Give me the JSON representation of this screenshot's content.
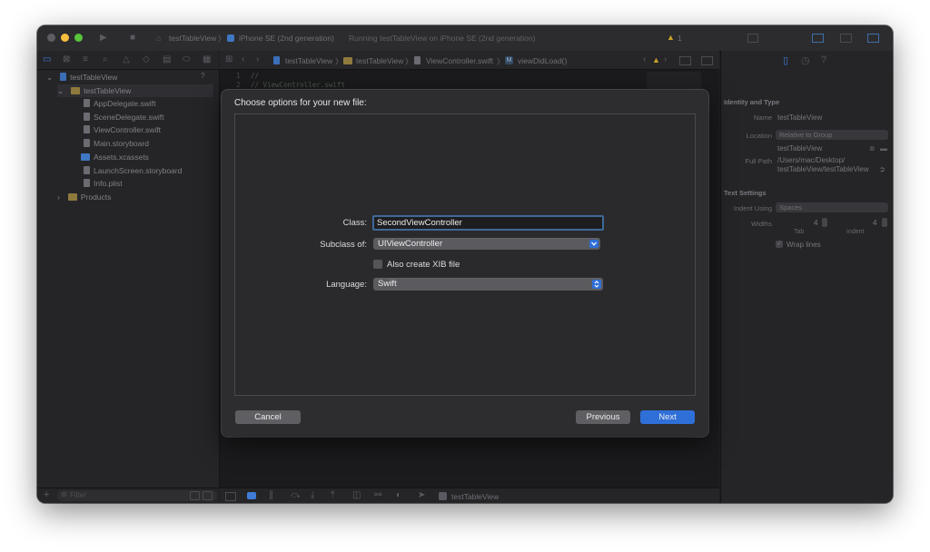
{
  "toolbar": {
    "scheme": "testTableView",
    "device": "iPhone SE (2nd generation)",
    "status": "Running testTableView on iPhone SE (2nd generation)",
    "warning_count": "1"
  },
  "jumpbar": {
    "items": [
      "testTableView",
      "testTableView",
      "ViewController.swift",
      "viewDidLoad()"
    ]
  },
  "editor": {
    "lines": [
      "//",
      "//  ViewController.swift"
    ],
    "line_numbers": [
      "1",
      "2"
    ]
  },
  "navigator": {
    "items": [
      {
        "label": "testTableView",
        "type": "project"
      },
      {
        "label": "testTableView",
        "type": "folder"
      },
      {
        "label": "AppDelegate.swift",
        "type": "file"
      },
      {
        "label": "SceneDelegate.swift",
        "type": "file"
      },
      {
        "label": "ViewController.swift",
        "type": "file"
      },
      {
        "label": "Main.storyboard",
        "type": "file"
      },
      {
        "label": "Assets.xcassets",
        "type": "asset"
      },
      {
        "label": "LaunchScreen.storyboard",
        "type": "file"
      },
      {
        "label": "Info.plist",
        "type": "file"
      },
      {
        "label": "Products",
        "type": "folder"
      }
    ],
    "badge": "?",
    "filter_placeholder": "Filter"
  },
  "debugbar": {
    "target": "testTableView"
  },
  "inspector": {
    "identity_header": "Identity and Type",
    "name_label": "Name",
    "name_value": "testTableView",
    "location_label": "Location",
    "location_value": "Relative to Group",
    "location_file": "testTableView",
    "fullpath_label": "Full Path",
    "fullpath_value_1": "/Users/mac/Desktop/",
    "fullpath_value_2": "testTableView/testTableView",
    "text_header": "Text Settings",
    "indent_label": "Indent Using",
    "indent_value": "Spaces",
    "widths_label": "Widths",
    "tab_value": "4",
    "indent_width_value": "4",
    "tab_label": "Tab",
    "indent_sublabel": "Indent",
    "wrap_label": "Wrap lines"
  },
  "dialog": {
    "title": "Choose options for your new file:",
    "class_label": "Class:",
    "class_value": "SecondViewController",
    "subclass_label": "Subclass of:",
    "subclass_value": "UIViewController",
    "xib_label": "Also create XIB file",
    "language_label": "Language:",
    "language_value": "Swift",
    "cancel": "Cancel",
    "previous": "Previous",
    "next": "Next"
  },
  "colors": {
    "accent": "#2f6fd8",
    "field_focus": "#3d6a99"
  }
}
